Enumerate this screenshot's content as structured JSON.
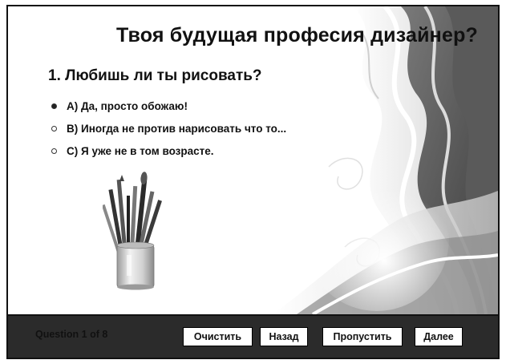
{
  "quiz": {
    "title": "Твоя будущая професия дизайнер?",
    "question": "1. Любишь ли ты рисовать?",
    "options": [
      {
        "label": "А) Да, просто обожаю!",
        "selected": true
      },
      {
        "label": "В) Иногда не против нарисовать что то...",
        "selected": false
      },
      {
        "label": "С) Я уже не в том возрасте.",
        "selected": false
      }
    ]
  },
  "footer": {
    "question_counter": "Question 1 of 8",
    "clear_label": "Очистить",
    "back_label": "Назад",
    "skip_label": "Пропустить",
    "next_label": "Далее"
  },
  "colors": {
    "footer_background": "#2b2b2b",
    "text": "#111111",
    "button_background": "#ffffff"
  },
  "icons": {
    "illustration": "pencil-cup-icon",
    "background": "decorative-swirl-background"
  }
}
